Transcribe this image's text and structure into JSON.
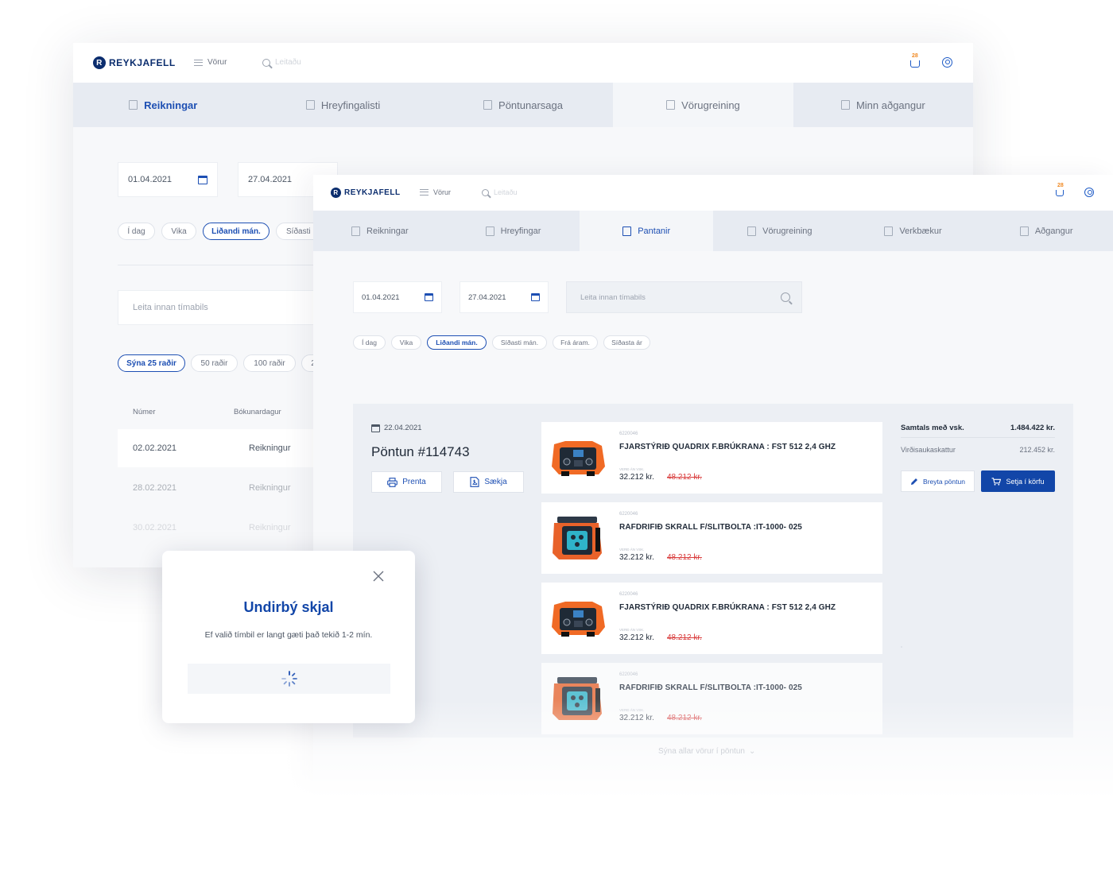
{
  "brand": "REYKJAFELL",
  "colors": {
    "accent": "#1d4fb3",
    "primary_button": "#1246a8",
    "old_price": "#d93b3b",
    "cart_badge": "#f08a24"
  },
  "back": {
    "nav_label": "Vörur",
    "search_placeholder": "Leitaðu",
    "cart_count": "28",
    "tabs": [
      "Reikningar",
      "Hreyfingalisti",
      "Pöntunarsaga",
      "Vörugreining",
      "Minn aðgangur"
    ],
    "date_from": "01.04.2021",
    "date_to": "27.04.2021",
    "periods": [
      "Í dag",
      "Vika",
      "Liðandi mán.",
      "Síðasti m"
    ],
    "search_placeholder_period": "Leita innan tímabils",
    "rows_options": [
      "Sýna 25 raðir",
      "50 raðir",
      "100 raðir",
      "2"
    ],
    "columns": [
      "Númer",
      "Bókunardagur"
    ],
    "rows": [
      {
        "date": "02.02.2021",
        "type": "Reikningur"
      },
      {
        "date": "28.02.2021",
        "type": "Reikningur"
      },
      {
        "date": "30.02.2021",
        "type": "Reikningur"
      }
    ]
  },
  "front": {
    "nav_label": "Vörur",
    "search_placeholder": "Leitaðu",
    "cart_count": "28",
    "tabs": [
      "Reikningar",
      "Hreyfingar",
      "Pantanir",
      "Vörugreining",
      "Verkbækur",
      "Aðgangur"
    ],
    "active_tab": "Pantanir",
    "date_from": "01.04.2021",
    "date_to": "27.04.2021",
    "search_placeholder_period": "Leita innan tímabils",
    "periods": [
      "Í dag",
      "Vika",
      "Liðandi mán.",
      "Síðasti mán.",
      "Frá áram.",
      "Síðasta ár"
    ],
    "order": {
      "date": "22.04.2021",
      "title": "Pöntun #114743",
      "print_label": "Prenta",
      "download_label": "Sækja",
      "total_label": "Samtals með vsk.",
      "total_value": "1.484.422 kr.",
      "vat_label": "Virðisaukaskattur",
      "vat_value": "212.452 kr.",
      "edit_label": "Breyta pöntun",
      "add_to_cart_label": "Setja í körfu",
      "show_all_label": "Sýna allar vörur í pöntun",
      "products": [
        {
          "sku": "6220046",
          "name": "FJARSTÝRIÐ QUADRIX F.BRÚKRANA : FST 512 2,4 GHZ",
          "vat_label": "VERÐ ÁN VSK.",
          "price": "32.212 kr.",
          "old_price": "48.212 kr.",
          "image": "remote-controller"
        },
        {
          "sku": "6220046",
          "name": "RAFDRIFIÐ SKRALL F/SLITBOLTA :IT-1000- 025",
          "vat_label": "VERÐ ÁN VSK.",
          "price": "32.212 kr.",
          "old_price": "48.212 kr.",
          "image": "ratchet-tool"
        },
        {
          "sku": "6220046",
          "name": "FJARSTÝRIÐ QUADRIX F.BRÚKRANA : FST 512 2,4 GHZ",
          "vat_label": "VERÐ ÁN VSK.",
          "price": "32.212 kr.",
          "old_price": "48.212 kr.",
          "image": "remote-controller"
        },
        {
          "sku": "6220046",
          "name": "RAFDRIFIÐ SKRALL F/SLITBOLTA :IT-1000- 025",
          "vat_label": "VERÐ ÁN VSK.",
          "price": "32.212 kr.",
          "old_price": "48.212 kr.",
          "image": "ratchet-tool"
        }
      ]
    }
  },
  "modal": {
    "title": "Undirbý skjal",
    "message": "Ef valið tímbil er langt gæti það tekið 1-2 mín."
  }
}
